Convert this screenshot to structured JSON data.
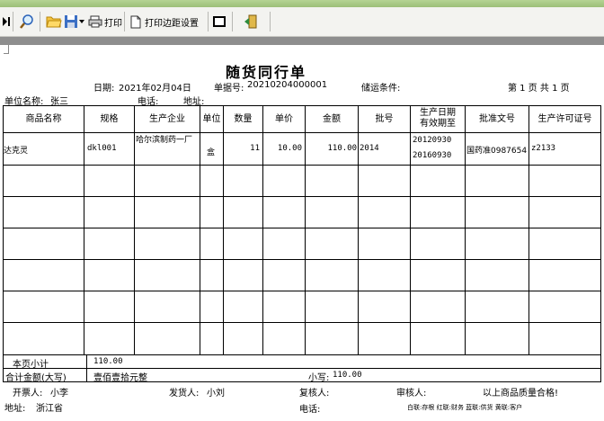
{
  "toolbar": {
    "print_label": "打印",
    "margin_label": "打印边距设置"
  },
  "document": {
    "title": "随货同行单",
    "date_label": "日期:",
    "date_value": "2021年02月04日",
    "doc_no_label": "单据号:",
    "doc_no_value": "20210204000001",
    "storage_label": "储运条件:",
    "page_info": "第 1 页 共 1 页",
    "unit_label": "单位名称:",
    "unit_value": "张三",
    "phone_label": "电话:",
    "address_label": "地址:"
  },
  "table": {
    "headers": [
      "商品名称",
      "规格",
      "生产企业",
      "单位",
      "数量",
      "单价",
      "金额",
      "批号",
      "生产日期\n有效期至",
      "批准文号",
      "生产许可证号"
    ],
    "rows": [
      {
        "name": "达克灵",
        "spec": "dkl001",
        "maker": "哈尔滨制药一厂",
        "unit": "盒",
        "qty": "11",
        "price": "10.00",
        "amount": "110.00",
        "batch": "2014",
        "prod_date": "20120930",
        "expiry": "20160930",
        "approval": "国药准0987654",
        "license": "z2133"
      }
    ]
  },
  "summary": {
    "page_subtotal_label": "本页小计",
    "page_subtotal_value": "110.00",
    "total_label": "合计金额(大写)",
    "total_upper": "壹佰壹拾元整",
    "total_small_label": "小写:",
    "total_small_value": "110.00"
  },
  "footer": {
    "drawer_label": "开票人:",
    "drawer_value": "小李",
    "shipper_label": "发货人:",
    "shipper_value": "小刘",
    "checker_label": "复核人:",
    "auditor_label": "审核人:",
    "quality_note": "以上商品质量合格!",
    "address_label": "地址:",
    "address_value": "浙江省",
    "phone_label": "电话:",
    "copies_note": "白联:存根 红联:财务 蓝联:供货 黄联:客户"
  }
}
